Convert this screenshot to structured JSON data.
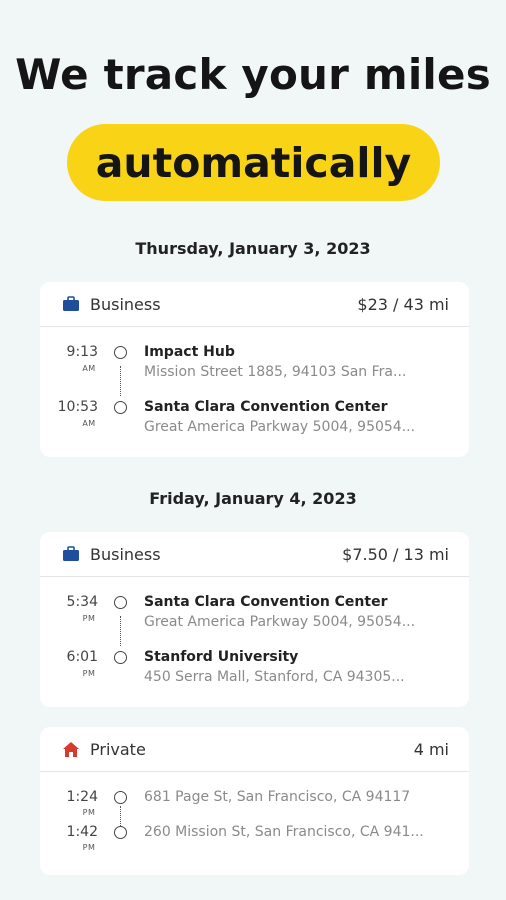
{
  "headline": "We track your miles",
  "highlight": "automatically",
  "colors": {
    "background": "#f1f7f7",
    "highlight": "#f9d416",
    "business_icon": "#1f4e9c",
    "private_icon": "#d83a2e"
  },
  "days": [
    {
      "date": "Thursday, January 3, 2023",
      "trips": [
        {
          "category": "Business",
          "icon": "briefcase-icon",
          "amount": "$23 / 43 mi",
          "stops": [
            {
              "time": "9:13",
              "ampm": "AM",
              "place": "Impact Hub",
              "address": "Mission Street 1885, 94103 San Fra..."
            },
            {
              "time": "10:53",
              "ampm": "AM",
              "place": "Santa Clara Convention Center",
              "address": "Great America Parkway 5004, 95054..."
            }
          ]
        }
      ]
    },
    {
      "date": "Friday, January 4, 2023",
      "trips": [
        {
          "category": "Business",
          "icon": "briefcase-icon",
          "amount": "$7.50 / 13 mi",
          "stops": [
            {
              "time": "5:34",
              "ampm": "PM",
              "place": "Santa Clara Convention Center",
              "address": "Great America Parkway 5004, 95054..."
            },
            {
              "time": "6:01",
              "ampm": "PM",
              "place": "Stanford University",
              "address": "450 Serra Mall, Stanford, CA 94305..."
            }
          ]
        },
        {
          "category": "Private",
          "icon": "home-icon",
          "amount": "4 mi",
          "stops": [
            {
              "time": "1:24",
              "ampm": "PM",
              "address": "681 Page St, San Francisco, CA 94117"
            },
            {
              "time": "1:42",
              "ampm": "PM",
              "address": "260 Mission St, San Francisco, CA 941..."
            }
          ]
        }
      ]
    }
  ]
}
